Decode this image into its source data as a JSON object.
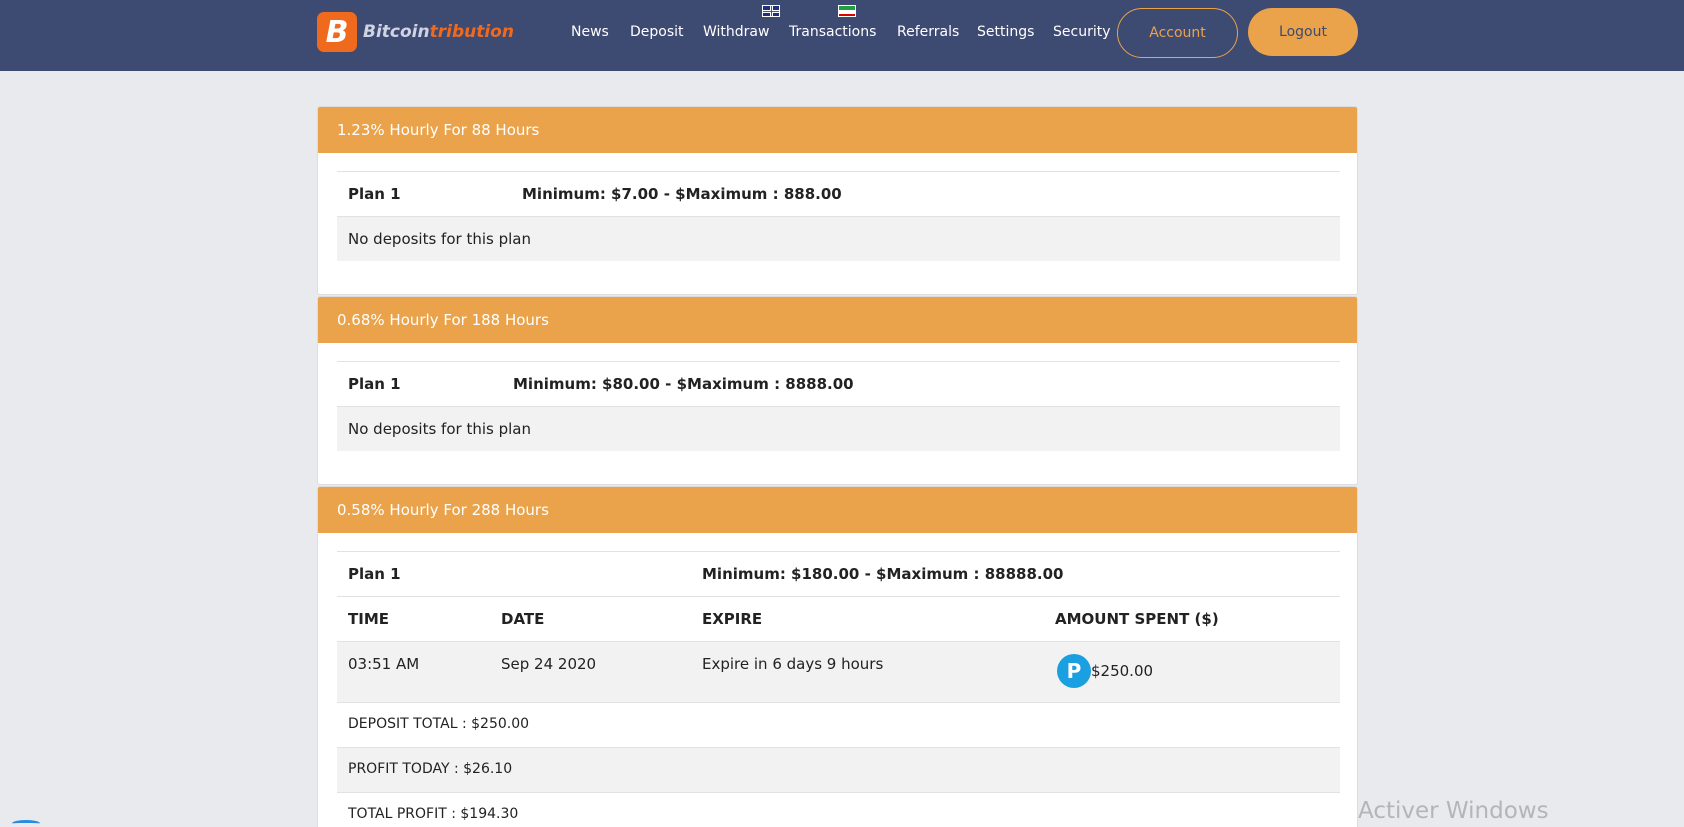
{
  "header": {
    "logo_badge": "B",
    "logo_text_1": "Bitcoin",
    "logo_text_2": "tribution",
    "nav": [
      "News",
      "Deposit",
      "Withdraw",
      "Transactions",
      "Referrals",
      "Settings",
      "Security"
    ],
    "account_label": "Account",
    "logout_label": "Logout"
  },
  "colors": {
    "header_bg": "#3d4a72",
    "accent": "#eaa34a",
    "logo_orange": "#f06a1e",
    "payment_blue": "#1a9fe0"
  },
  "plans": [
    {
      "title": "1.23% Hourly For 88 Hours",
      "name": "Plan 1",
      "limits": "Minimum: $7.00 - $Maximum : 888.00",
      "empty": "No deposits for this plan"
    },
    {
      "title": "0.68% Hourly For 188 Hours",
      "name": "Plan 1",
      "limits": "Minimum: $80.00 - $Maximum : 8888.00",
      "empty": "No deposits for this plan"
    },
    {
      "title": "0.58% Hourly For 288 Hours",
      "name": "Plan 1",
      "limits": "Minimum: $180.00 - $Maximum : 88888.00",
      "columns": [
        "TIME",
        "DATE",
        "EXPIRE",
        "AMOUNT SPENT ($)"
      ],
      "deposit": {
        "time": "03:51 AM",
        "date": "Sep 24 2020",
        "expire": "Expire in 6 days 9 hours",
        "payment_icon": "P",
        "amount": "$250.00"
      },
      "deposit_total": "DEPOSIT TOTAL : $250.00",
      "profit_today": "PROFIT TODAY : $26.10",
      "total_profit": "TOTAL PROFIT : $194.30"
    }
  ],
  "watermark": "Activer Windows"
}
